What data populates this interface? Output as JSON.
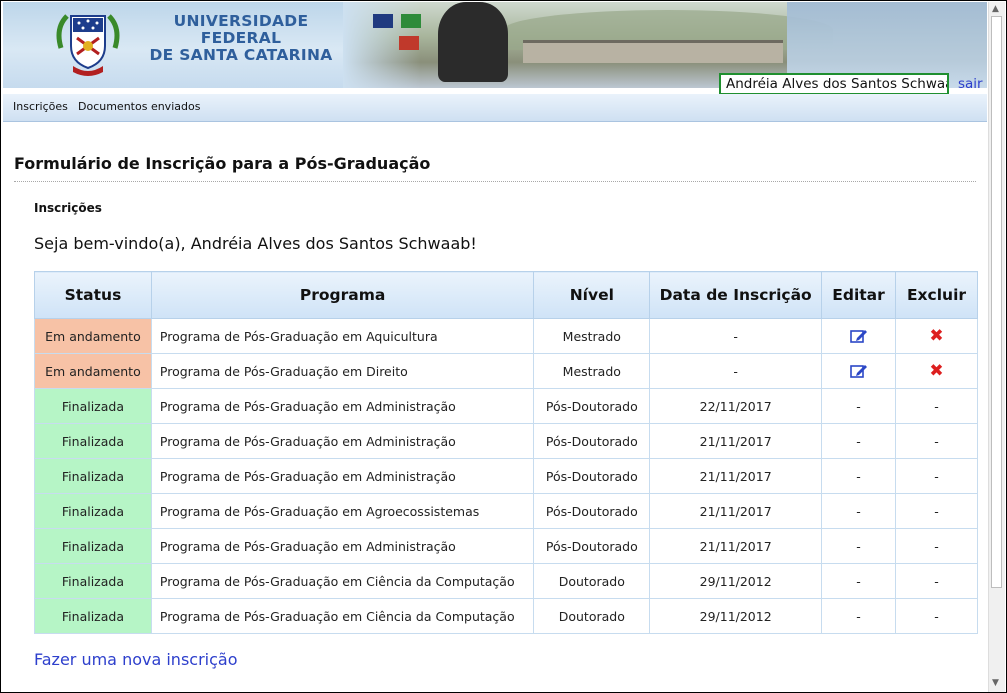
{
  "header": {
    "university_line1": "UNIVERSIDADE FEDERAL",
    "university_line2": "DE SANTA CATARINA",
    "user_name": "Andréia Alves dos Santos Schwaab",
    "logout_label": "sair"
  },
  "nav": {
    "items": [
      {
        "label": "Inscrições"
      },
      {
        "label": "Documentos enviados"
      }
    ]
  },
  "page": {
    "title": "Formulário de Inscrição para a Pós-Graduação",
    "section_title": "Inscrições",
    "welcome": "Seja bem-vindo(a), Andréia Alves dos Santos Schwaab!",
    "new_subscription_link": "Fazer uma nova inscrição"
  },
  "table": {
    "headers": {
      "status": "Status",
      "program": "Programa",
      "level": "Nível",
      "date": "Data de Inscrição",
      "edit": "Editar",
      "delete": "Excluir"
    },
    "rows": [
      {
        "status": "Em andamento",
        "program": "Programa de Pós-Graduação em Aquicultura",
        "level": "Mestrado",
        "date": "-",
        "edit": "edit-icon",
        "delete": "delete-icon"
      },
      {
        "status": "Em andamento",
        "program": "Programa de Pós-Graduação em Direito",
        "level": "Mestrado",
        "date": "-",
        "edit": "edit-icon",
        "delete": "delete-icon"
      },
      {
        "status": "Finalizada",
        "program": "Programa de Pós-Graduação em Administração",
        "level": "Pós-Doutorado",
        "date": "22/11/2017",
        "edit": "-",
        "delete": "-"
      },
      {
        "status": "Finalizada",
        "program": "Programa de Pós-Graduação em Administração",
        "level": "Pós-Doutorado",
        "date": "21/11/2017",
        "edit": "-",
        "delete": "-"
      },
      {
        "status": "Finalizada",
        "program": "Programa de Pós-Graduação em Administração",
        "level": "Pós-Doutorado",
        "date": "21/11/2017",
        "edit": "-",
        "delete": "-"
      },
      {
        "status": "Finalizada",
        "program": "Programa de Pós-Graduação em Agroecossistemas",
        "level": "Pós-Doutorado",
        "date": "21/11/2017",
        "edit": "-",
        "delete": "-"
      },
      {
        "status": "Finalizada",
        "program": "Programa de Pós-Graduação em Administração",
        "level": "Pós-Doutorado",
        "date": "21/11/2017",
        "edit": "-",
        "delete": "-"
      },
      {
        "status": "Finalizada",
        "program": "Programa de Pós-Graduação em Ciência da Computação",
        "level": "Doutorado",
        "date": "29/11/2012",
        "edit": "-",
        "delete": "-"
      },
      {
        "status": "Finalizada",
        "program": "Programa de Pós-Graduação em Ciência da Computação",
        "level": "Doutorado",
        "date": "29/11/2012",
        "edit": "-",
        "delete": "-"
      }
    ]
  },
  "colors": {
    "status_em_andamento": "#f7c2a6",
    "status_finalizada": "#b6f5c6",
    "link": "#2d3fcc",
    "user_box_border": "#1f8f2f",
    "delete_icon": "#dd1f1f",
    "edit_icon": "#2b47c6"
  }
}
